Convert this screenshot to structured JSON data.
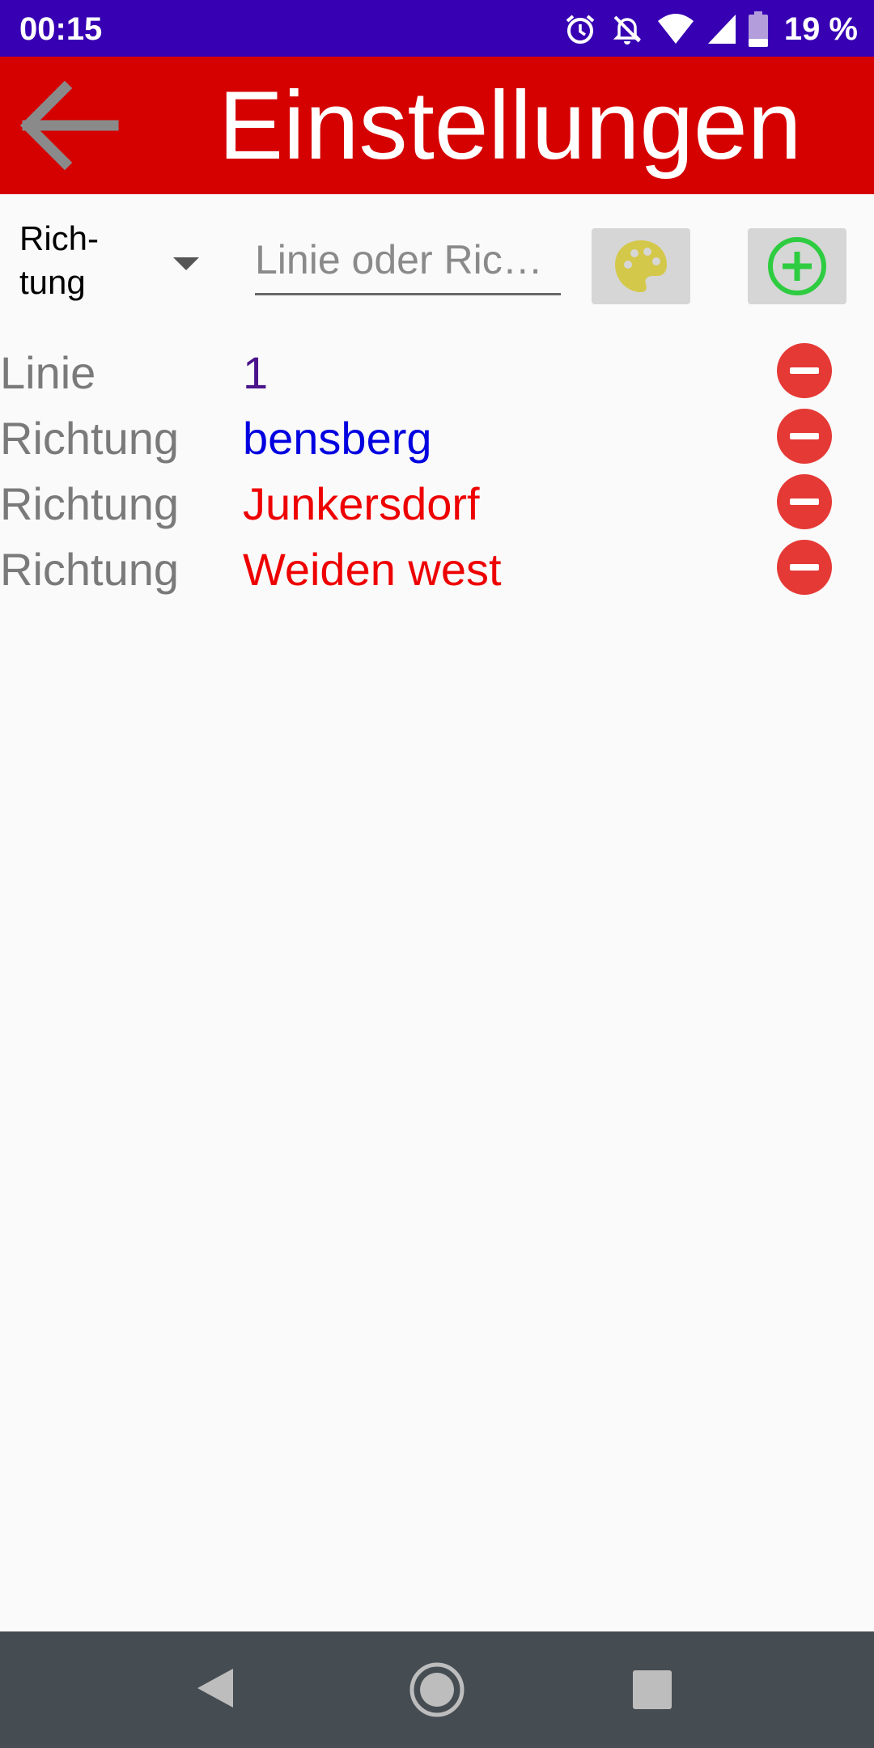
{
  "status_bar": {
    "time": "00:15",
    "battery": "19 %",
    "icons": [
      "alarm-icon",
      "bell-off-icon",
      "wifi-icon",
      "signal-icon",
      "battery-icon"
    ]
  },
  "app_bar": {
    "title": "Einstellungen",
    "back_icon": "arrow-left-icon"
  },
  "controls": {
    "type_selector": "Rich-\ntung",
    "search_placeholder": "Linie oder Ric…",
    "palette_icon": "palette-icon",
    "add_icon": "plus-circle-icon"
  },
  "entries": [
    {
      "type": "Linie",
      "value": "1",
      "color": "#4a148c"
    },
    {
      "type": "Richtung",
      "value": "bensberg",
      "color": "#0000e0"
    },
    {
      "type": "Richtung",
      "value": "Junkersdorf",
      "color": "#ee0000"
    },
    {
      "type": "Richtung",
      "value": "Weiden west",
      "color": "#ee0000"
    }
  ],
  "colors": {
    "status_bar": "#3700b3",
    "app_bar": "#d50000",
    "remove": "#e53935",
    "add": "#2ecc40",
    "palette": "#d4c84a",
    "nav_bar": "#464d52"
  },
  "nav_bar": [
    "back-triangle-icon",
    "home-circle-icon",
    "recents-square-icon"
  ]
}
